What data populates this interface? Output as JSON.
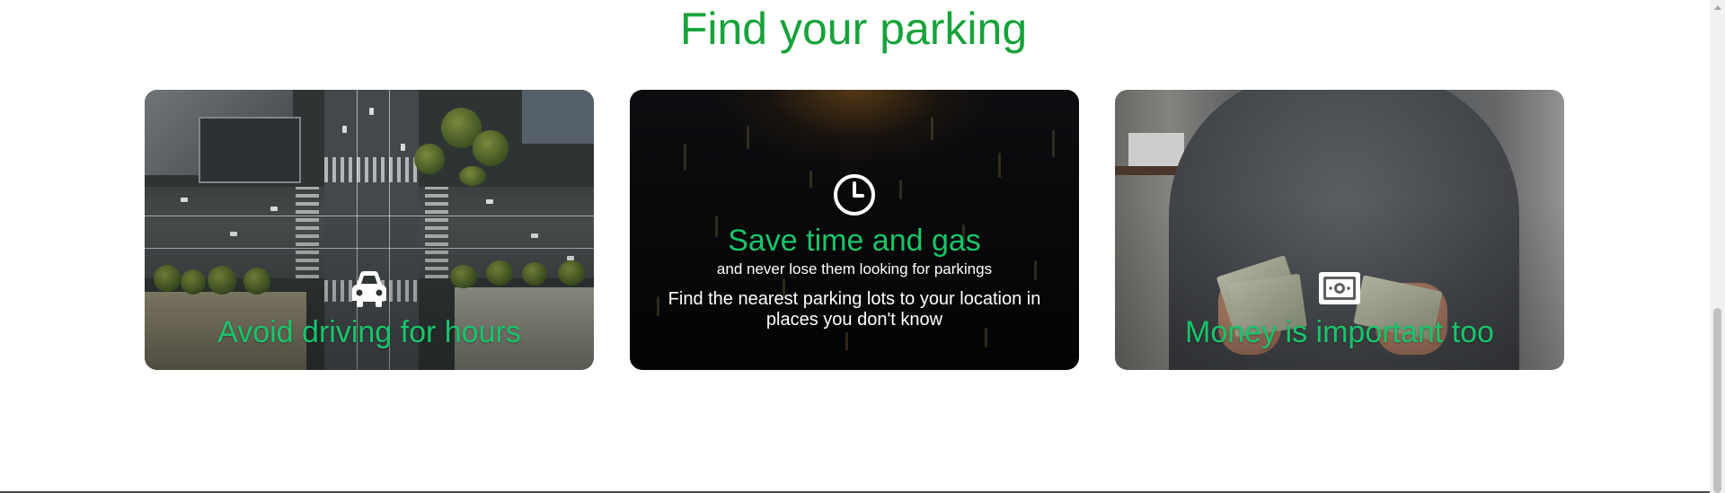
{
  "page": {
    "title": "Find your parking",
    "accent_color": "#17a23a",
    "card_title_color": "#18c56b"
  },
  "cards": [
    {
      "title": "Avoid driving for hours",
      "icon": "car-icon",
      "image": "aerial city intersection"
    },
    {
      "title": "Save time and gas",
      "subtitle": "and never lose them looking for parkings",
      "description": "Find the nearest parking lots to your location in places you don't know",
      "icon": "clock-icon",
      "image": "traffic jam at night"
    },
    {
      "title": "Money is important too",
      "icon": "money-bill-icon",
      "image": "person counting money"
    }
  ],
  "scrollbar": {
    "position_fraction": 1.0
  }
}
